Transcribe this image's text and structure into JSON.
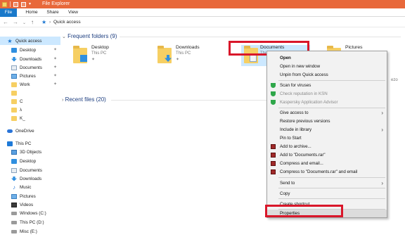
{
  "window": {
    "title": "File Explorer"
  },
  "ribbon": {
    "tabs": [
      "File",
      "Home",
      "Share",
      "View"
    ]
  },
  "address": {
    "back": "←",
    "forward": "→",
    "recent": "⌄",
    "up": "↑",
    "path": "Quick access"
  },
  "sidebar": {
    "quick_access": "Quick access",
    "items": [
      {
        "label": "Desktop",
        "icon": "desktop-icon",
        "pinned": true
      },
      {
        "label": "Downloads",
        "icon": "download-icon",
        "pinned": true
      },
      {
        "label": "Documents",
        "icon": "documents-icon",
        "pinned": true
      },
      {
        "label": "Pictures",
        "icon": "pictures-icon",
        "pinned": true
      },
      {
        "label": "Work",
        "icon": "folder-icon",
        "pinned": true
      },
      {
        "label": "",
        "icon": "folder-icon",
        "pinned": false
      },
      {
        "label": "C",
        "icon": "folder-icon",
        "pinned": false
      },
      {
        "label": "λ",
        "icon": "folder-icon",
        "pinned": false
      },
      {
        "label": "K_",
        "icon": "folder-icon",
        "pinned": false
      }
    ],
    "onedrive": "OneDrive",
    "this_pc": "This PC",
    "pc_items": [
      {
        "label": "3D Objects",
        "icon": "3d-objects-icon"
      },
      {
        "label": "Desktop",
        "icon": "desktop-icon"
      },
      {
        "label": "Documents",
        "icon": "documents-icon"
      },
      {
        "label": "Downloads",
        "icon": "download-icon"
      },
      {
        "label": "Music",
        "icon": "music-icon"
      },
      {
        "label": "Pictures",
        "icon": "pictures-icon"
      },
      {
        "label": "Videos",
        "icon": "videos-icon"
      },
      {
        "label": "Windows (C:)",
        "icon": "drive-icon"
      },
      {
        "label": "This PC (D:)",
        "icon": "drive-icon"
      },
      {
        "label": "Misc (E:)",
        "icon": "drive-icon"
      }
    ],
    "pin_glyph": "📌"
  },
  "main": {
    "frequent_header": "Frequent folders (9)",
    "recent_header": "Recent files (20)",
    "folders": [
      {
        "name": "Desktop",
        "location": "This PC"
      },
      {
        "name": "Downloads",
        "location": "This PC"
      },
      {
        "name": "Documents",
        "location": "This PC"
      },
      {
        "name": "Pictures",
        "location": ""
      }
    ],
    "partial_text": "ezo"
  },
  "context_menu": {
    "items": [
      {
        "label": "Open",
        "bold": true
      },
      {
        "label": "Open in new window"
      },
      {
        "label": "Unpin from Quick access"
      },
      {
        "label": "Scan for viruses",
        "icon": "kaspersky-icon"
      },
      {
        "label": "Check reputation in KSN",
        "icon": "kaspersky-icon",
        "disabled": true
      },
      {
        "label": "Kaspersky Application Advisor",
        "icon": "kaspersky-icon",
        "disabled": true
      },
      {
        "label": "Give access to",
        "submenu": true
      },
      {
        "label": "Restore previous versions"
      },
      {
        "label": "Include in library",
        "submenu": true
      },
      {
        "label": "Pin to Start"
      },
      {
        "label": "Add to archive...",
        "icon": "winrar-icon"
      },
      {
        "label": "Add to \"Documents.rar\"",
        "icon": "winrar-icon"
      },
      {
        "label": "Compress and email...",
        "icon": "winrar-icon"
      },
      {
        "label": "Compress to \"Documents.rar\" and email",
        "icon": "winrar-icon"
      },
      {
        "label": "Send to",
        "submenu": true
      },
      {
        "label": "Copy"
      },
      {
        "label": "Create shortcut"
      },
      {
        "label": "Properties",
        "hovered": true
      }
    ],
    "submenu_arrow": "›"
  },
  "colors": {
    "titlebar": "#e8683a",
    "file_tab": "#1979ca",
    "highlight_box": "#d9172a",
    "selection": "#cce8ff"
  }
}
